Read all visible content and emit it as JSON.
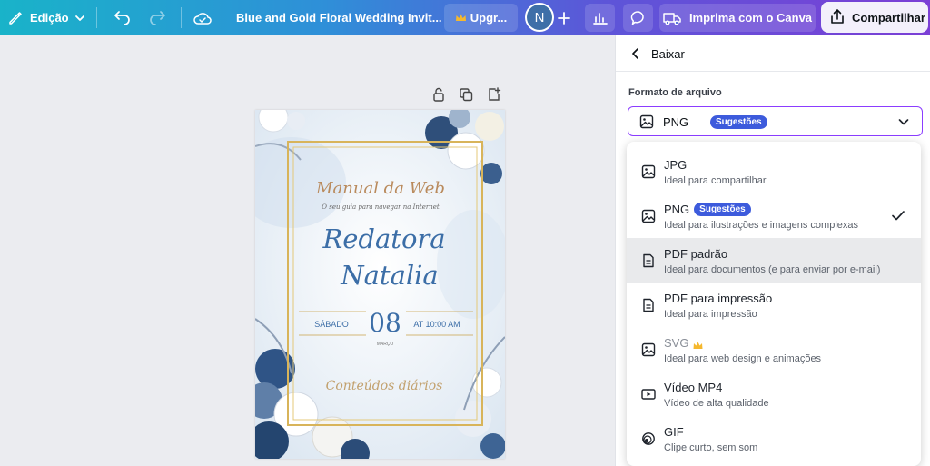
{
  "topbar": {
    "edit_label": "Edição",
    "doc_title": "Blue and Gold Floral Wedding Invit...",
    "upgrade_label": "Upgr...",
    "avatar_initial": "N",
    "print_label": "Imprima com o Canva",
    "share_label": "Compartilhar",
    "icons": [
      "pencil-icon",
      "chevron-down-icon",
      "undo-icon",
      "redo-icon",
      "cloud-save-icon",
      "crown-icon",
      "plus-icon",
      "bar-chart-icon",
      "comment-icon",
      "truck-icon",
      "share-upload-icon"
    ]
  },
  "canvas": {
    "page_tools": [
      "lock-icon",
      "duplicate-icon",
      "add-page-icon"
    ],
    "invite": {
      "brand": "Manual da Web",
      "tagline": "O seu guia para navegar na Internet",
      "name_line1": "Redatora",
      "name_line2": "Natalia",
      "day_label": "SÁBADO",
      "day_number": "08",
      "time_label": "AT 10:00 AM",
      "month_label": "MARÇO",
      "footer": "Conteúdos diários"
    }
  },
  "panel": {
    "back_label": "Baixar",
    "field_label": "Formato de arquivo",
    "selected_format": "PNG",
    "selected_badge": "Sugestões",
    "options": [
      {
        "name": "JPG",
        "desc": "Ideal para compartilhar",
        "icon": "image-icon"
      },
      {
        "name": "PNG",
        "badge": "Sugestões",
        "desc": "Ideal para ilustrações e imagens complexas",
        "icon": "image-icon",
        "selected": true
      },
      {
        "name": "PDF padrão",
        "desc": "Ideal para documentos (e para enviar por e-mail)",
        "icon": "document-icon",
        "highlighted": true
      },
      {
        "name": "PDF para impressão",
        "desc": "Ideal para impressão",
        "icon": "document-icon"
      },
      {
        "name": "SVG",
        "desc": "Ideal para web design e animações",
        "icon": "image-icon",
        "premium": true
      },
      {
        "name": "Vídeo MP4",
        "desc": "Vídeo de alta qualidade",
        "icon": "video-icon"
      },
      {
        "name": "GIF",
        "desc": "Clipe curto, sem som",
        "icon": "gif-icon"
      }
    ]
  },
  "colors": {
    "accent_purple": "#8b3dff",
    "badge_blue": "#3d5bdc",
    "invite_blue": "#3c6ea7",
    "invite_gold": "#c9a24a"
  }
}
